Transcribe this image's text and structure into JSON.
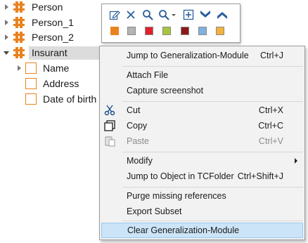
{
  "tree": {
    "nodes": [
      {
        "label": "Person"
      },
      {
        "label": "Person_1"
      },
      {
        "label": "Person_2"
      },
      {
        "label": "Insurant"
      }
    ],
    "attributes": [
      {
        "label": "Name"
      },
      {
        "label": "Address"
      },
      {
        "label": "Date of birth"
      }
    ]
  },
  "toolbar": {
    "buttons": [
      "edit-icon",
      "delete-icon",
      "zoom-in-icon",
      "zoom-dropdown-icon",
      "add-icon",
      "expand-all-icon",
      "collapse-all-icon"
    ],
    "swatches": [
      "#e8831f",
      "#b4b4b4",
      "#e0202a",
      "#a8c63a",
      "#8b1a1a",
      "#7fb2e0",
      "#f2b33a"
    ]
  },
  "context_menu": {
    "items": {
      "jump_generalization": {
        "label": "Jump to Generalization-Module",
        "shortcut": "Ctrl+J"
      },
      "attach_file": {
        "label": "Attach File"
      },
      "capture_screenshot": {
        "label": "Capture screenshot"
      },
      "cut": {
        "label": "Cut",
        "shortcut": "Ctrl+X"
      },
      "copy": {
        "label": "Copy",
        "shortcut": "Ctrl+C"
      },
      "paste": {
        "label": "Paste",
        "shortcut": "Ctrl+V"
      },
      "modify": {
        "label": "Modify"
      },
      "jump_tcfolder": {
        "label": "Jump to Object in TCFolder",
        "shortcut": "Ctrl+Shift+J"
      },
      "purge": {
        "label": "Purge missing references"
      },
      "export_subset": {
        "label": "Export Subset"
      },
      "clear_generalization": {
        "label": "Clear Generalization-Module"
      }
    }
  }
}
